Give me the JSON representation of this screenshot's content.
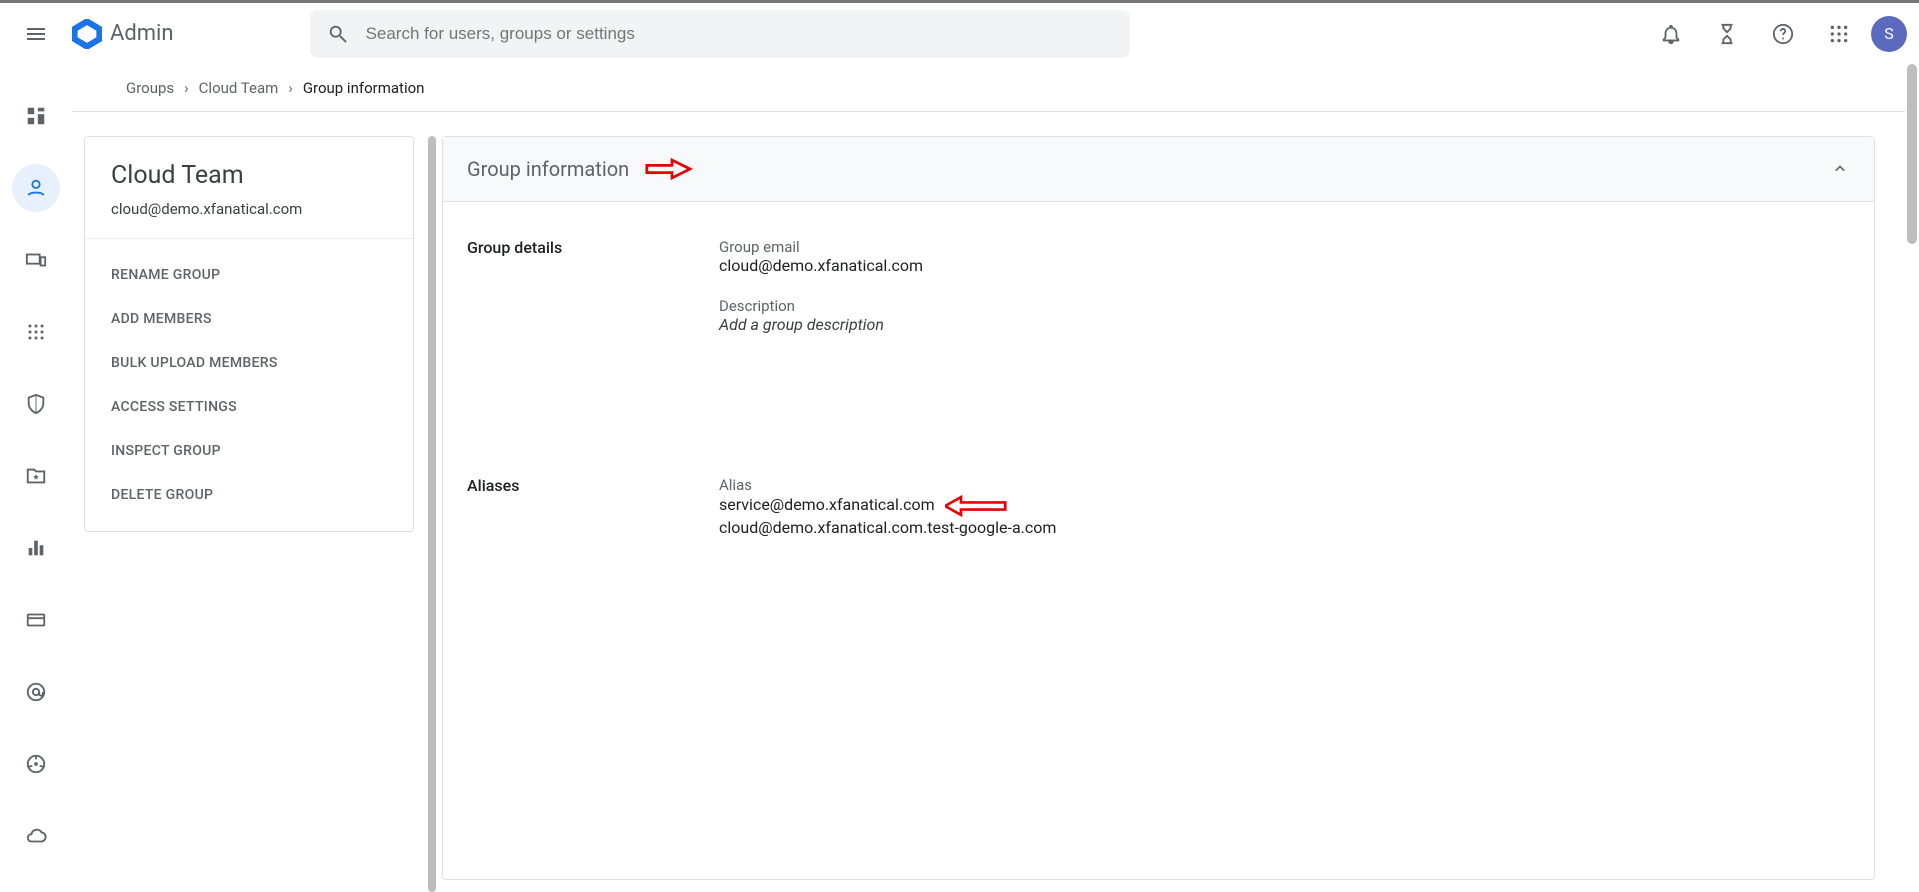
{
  "header": {
    "product_name": "Admin",
    "search_placeholder": "Search for users, groups or settings",
    "avatar_initial": "S"
  },
  "breadcrumb": {
    "items": [
      "Groups",
      "Cloud Team"
    ],
    "current": "Group information"
  },
  "group_sidebar": {
    "name": "Cloud Team",
    "email": "cloud@demo.xfanatical.com",
    "actions": [
      "RENAME GROUP",
      "ADD MEMBERS",
      "BULK UPLOAD MEMBERS",
      "ACCESS SETTINGS",
      "INSPECT GROUP",
      "DELETE GROUP"
    ]
  },
  "group_info_card": {
    "title": "Group information",
    "details": {
      "label": "Group details",
      "group_email_label": "Group email",
      "group_email": "cloud@demo.xfanatical.com",
      "description_label": "Description",
      "description_placeholder": "Add a group description"
    },
    "aliases": {
      "label": "Aliases",
      "alias_label": "Alias",
      "list": [
        "service@demo.xfanatical.com",
        "cloud@demo.xfanatical.com.test-google-a.com"
      ]
    }
  },
  "rail": {
    "items": [
      {
        "name": "dashboard-icon"
      },
      {
        "name": "users-icon"
      },
      {
        "name": "devices-icon"
      },
      {
        "name": "apps-grid-icon"
      },
      {
        "name": "shield-icon"
      },
      {
        "name": "starred-folder-icon"
      },
      {
        "name": "bar-chart-icon"
      },
      {
        "name": "card-icon"
      },
      {
        "name": "at-sign-icon"
      },
      {
        "name": "steering-icon"
      },
      {
        "name": "cloud-icon"
      }
    ]
  }
}
